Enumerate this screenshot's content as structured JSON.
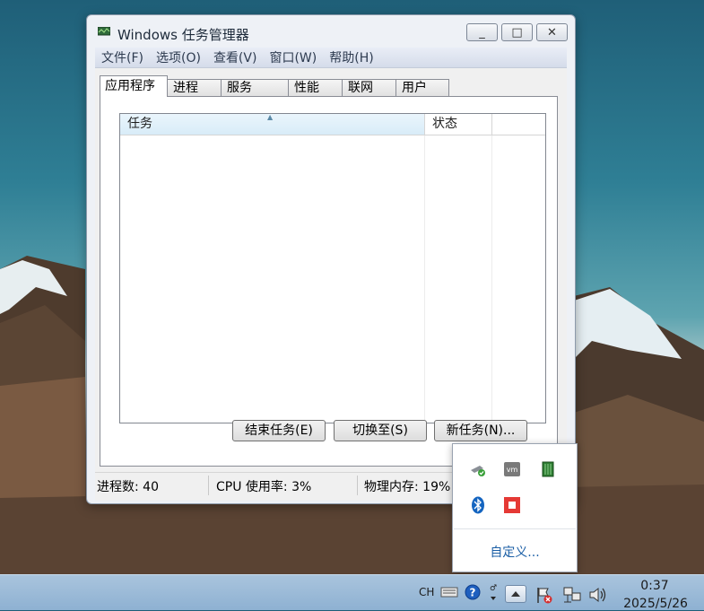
{
  "window": {
    "title": "Windows 任务管理器",
    "buttons": {
      "minimize": "_",
      "maximize": "□",
      "close": "✕"
    }
  },
  "menu": [
    "文件(F)",
    "选项(O)",
    "查看(V)",
    "窗口(W)",
    "帮助(H)"
  ],
  "tabs": [
    "应用程序",
    "进程",
    "服务",
    "性能",
    "联网",
    "用户"
  ],
  "active_tab": "应用程序",
  "list": {
    "columns": [
      "任务",
      "状态"
    ],
    "rows": []
  },
  "buttons": {
    "end_task": "结束任务(E)",
    "switch_to": "切换至(S)",
    "new_task": "新任务(N)..."
  },
  "status": {
    "processes": "进程数: 40",
    "cpu": "CPU 使用率: 3%",
    "memory": "物理内存: 19%"
  },
  "tray_popup": {
    "icons": [
      "network-shield-icon",
      "vmware-icon",
      "green-chip-icon",
      "bluetooth-icon",
      "red-stop-icon"
    ],
    "customize": "自定义..."
  },
  "taskbar": {
    "language": "CH",
    "icons": [
      "keyboard-icon",
      "help-icon",
      "pen-icon",
      "show-hidden-icons-icon",
      "action-center-icon",
      "network-icon",
      "volume-icon"
    ],
    "time": "0:37",
    "date": "2025/5/26"
  },
  "colors": {
    "accent": "#1a5ea5",
    "taskbar": "#9bbbd8",
    "window": "#eef1f6"
  }
}
